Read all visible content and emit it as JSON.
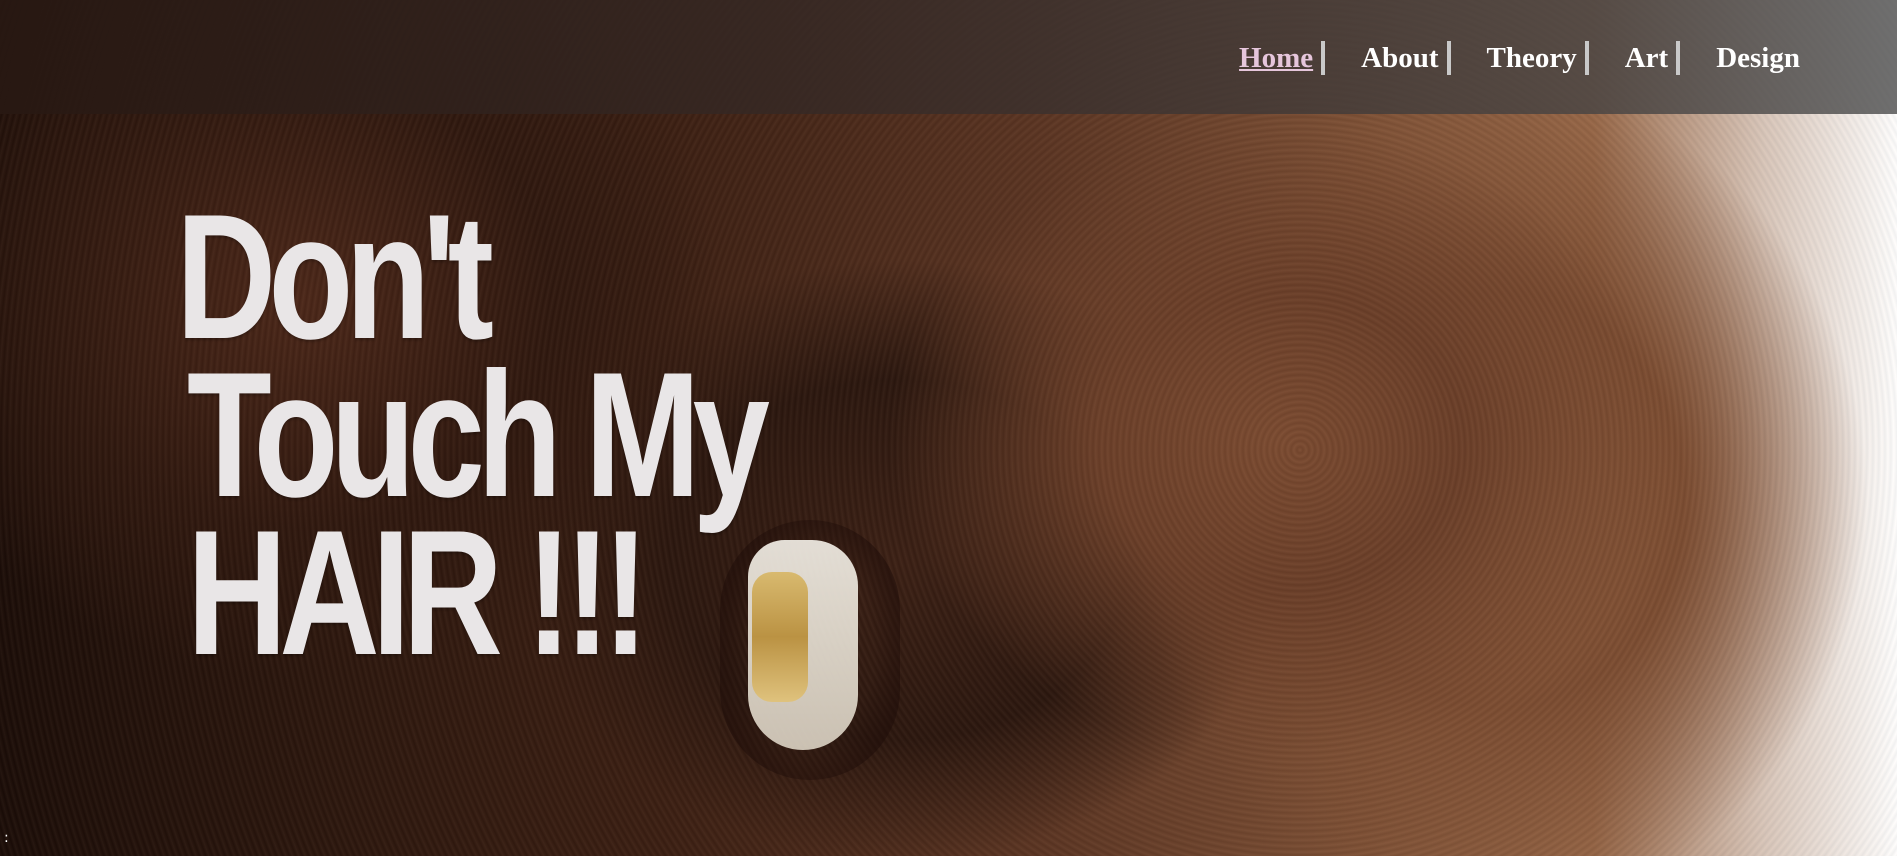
{
  "nav": {
    "items": [
      {
        "label": "Home",
        "active": true
      },
      {
        "label": "About",
        "active": false
      },
      {
        "label": "Theory",
        "active": false
      },
      {
        "label": "Art",
        "active": false
      },
      {
        "label": "Design",
        "active": false
      }
    ]
  },
  "hero": {
    "headline_line1": "Don't",
    "headline_line2": "Touch My",
    "headline_line3": "HAIR !!!",
    "image_description": "close-up portrait photo with large afro hair and gold grill teeth"
  },
  "colors": {
    "nav_text": "#ffffff",
    "nav_active": "#e6c6dc",
    "nav_separator": "#c9c9c9",
    "headline": "#e9e6e7"
  }
}
